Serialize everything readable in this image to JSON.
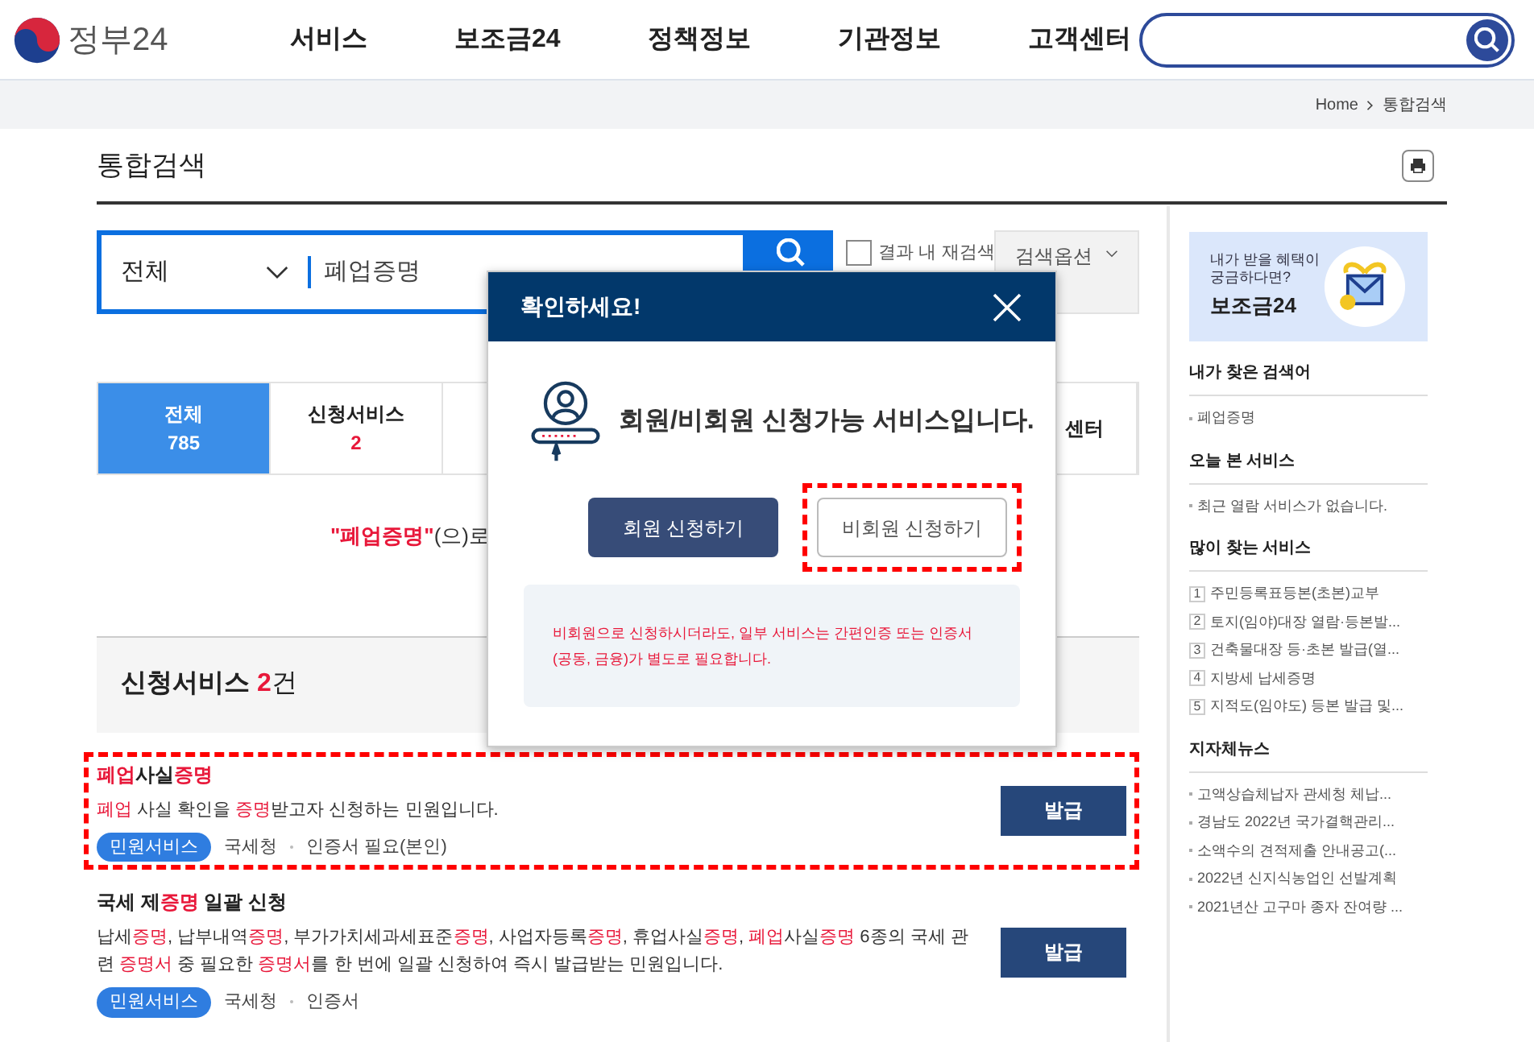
{
  "header": {
    "logo_text": "정부24",
    "nav": [
      "서비스",
      "보조금24",
      "정책정보",
      "기관정보",
      "고객센터"
    ]
  },
  "breadcrumb": [
    "Home",
    "통합검색"
  ],
  "page_title": "통합검색",
  "search": {
    "scope": "전체",
    "query": "폐업증명",
    "research_label": "결과 내 재검색",
    "research_checked": false,
    "options": "검색옵션"
  },
  "tabs": [
    {
      "label": "전체",
      "count": "785",
      "selected": true
    },
    {
      "label": "신청서비스",
      "count": "2",
      "selected": false
    },
    {
      "label": "센터",
      "selected": false
    }
  ],
  "notice": [
    {
      "text": "\"폐업증명\"",
      "highlight": true
    },
    {
      "text": "(으)로",
      "highlight": false
    }
  ],
  "results_section": {
    "title": "신청서비스",
    "count": "2",
    "unit": "건"
  },
  "results": [
    {
      "marked": true,
      "title": [
        {
          "text": "폐업",
          "highlight": true
        },
        {
          "text": "사실",
          "highlight": false
        },
        {
          "text": "증명",
          "highlight": true
        }
      ],
      "description": [
        {
          "text": "폐업",
          "highlight": true
        },
        {
          "text": " 사실 확인을 ",
          "highlight": false
        },
        {
          "text": "증명",
          "highlight": true
        },
        {
          "text": "받고자 신청하는 민원입니다.",
          "highlight": false
        }
      ],
      "tag": "민원서비스",
      "meta": [
        "국세청",
        "인증서 필요(본인)"
      ],
      "button": "발급"
    },
    {
      "marked": false,
      "title": [
        {
          "text": "국세 제",
          "highlight": false
        },
        {
          "text": "증명",
          "highlight": true
        },
        {
          "text": " 일괄 신청",
          "highlight": false
        }
      ],
      "description": [
        {
          "text": "납세",
          "highlight": false
        },
        {
          "text": "증명",
          "highlight": true
        },
        {
          "text": ", 납부내역",
          "highlight": false
        },
        {
          "text": "증명",
          "highlight": true
        },
        {
          "text": ", 부가가치세과세표준",
          "highlight": false
        },
        {
          "text": "증명",
          "highlight": true
        },
        {
          "text": ", 사업자등록",
          "highlight": false
        },
        {
          "text": "증명",
          "highlight": true
        },
        {
          "text": ", 휴업사실",
          "highlight": false
        },
        {
          "text": "증명",
          "highlight": true
        },
        {
          "text": ", ",
          "highlight": false
        },
        {
          "text": "폐업",
          "highlight": true
        },
        {
          "text": "사실",
          "highlight": false
        },
        {
          "text": "증명",
          "highlight": true
        },
        {
          "text": " 6종의 국세 관련 ",
          "highlight": false
        },
        {
          "text": "증명서",
          "highlight": true
        },
        {
          "text": " 중 필요한 ",
          "highlight": false
        },
        {
          "text": "증명서",
          "highlight": true
        },
        {
          "text": "를 한 번에 일괄 신청하여 즉시 발급받는 민원입니다.",
          "highlight": false
        }
      ],
      "tag": "민원서비스",
      "meta": [
        "국세청",
        "인증서"
      ],
      "button": "발급"
    }
  ],
  "sidebar": {
    "banner": {
      "lines": [
        "내가 받을 혜택이",
        "궁금하다면?"
      ],
      "brand": "보조금24"
    },
    "sections": [
      {
        "title": "내가 찾은 검색어",
        "kind": "bullets",
        "items": [
          {
            "text": "폐업증명"
          }
        ]
      },
      {
        "title": "오늘 본 서비스",
        "kind": "bullets",
        "items": [
          {
            "text": "최근 열람 서비스가 없습니다."
          }
        ]
      },
      {
        "title": "많이 찾는 서비스",
        "kind": "numbered",
        "items": [
          {
            "number": "1",
            "text": "주민등록표등본(초본)교부"
          },
          {
            "number": "2",
            "text": "토지(임야)대장 열람·등본발..."
          },
          {
            "number": "3",
            "text": "건축물대장 등·초본 발급(열..."
          },
          {
            "number": "4",
            "text": "지방세 납세증명"
          },
          {
            "number": "5",
            "text": "지적도(임야도) 등본 발급 및..."
          }
        ]
      },
      {
        "title": "지자체뉴스",
        "kind": "bullets",
        "items": [
          {
            "text": "고액상습체납자 관세청 체납..."
          },
          {
            "text": "경남도 2022년 국가결핵관리..."
          },
          {
            "text": "소액수의 견적제출 안내공고(..."
          },
          {
            "text": "2022년 신지식농업인 선발계획"
          },
          {
            "text": "2021년산 고구마 종자 잔여량 ..."
          }
        ]
      }
    ]
  },
  "modal": {
    "title": "확인하세요!",
    "message": "회원/비회원 신청가능 서비스입니다.",
    "buttons": [
      {
        "label": "회원 신청하기",
        "kind": "primary",
        "marked": false
      },
      {
        "label": "비회원 신청하기",
        "kind": "secondary",
        "marked": true
      }
    ],
    "note": "비회원으로 신청하시더라도, 일부 서비스는 간편인증 또는 인증서(공동, 금융)가 별도로 필요합니다."
  }
}
